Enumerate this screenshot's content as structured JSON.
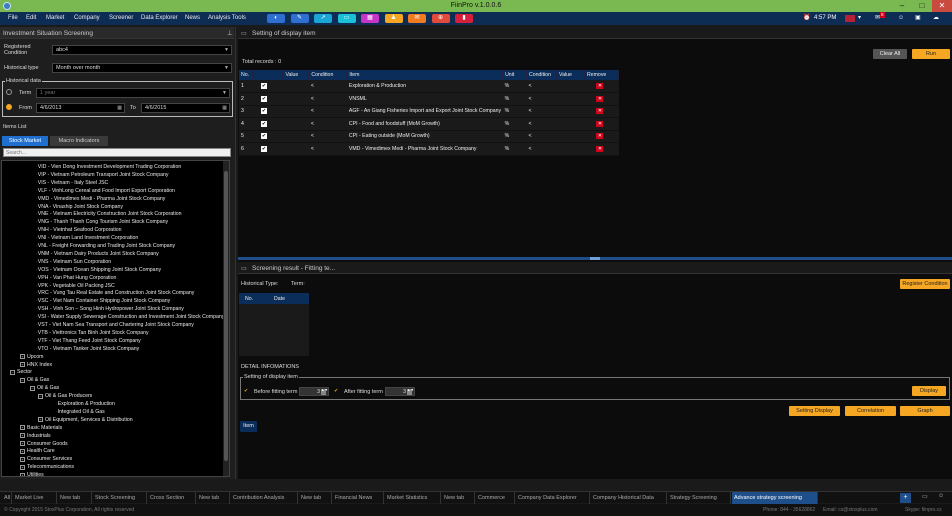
{
  "titlebar": {
    "title": "FiinPro v.1.0.0.6",
    "min": "–",
    "max": "□",
    "close": "✕"
  },
  "menu": [
    "File",
    "Edit",
    "Market",
    "Company",
    "Screener",
    "Data Explorer",
    "News",
    "Analysis Tools"
  ],
  "toolbar_icons": [
    {
      "icon": "chart-icon",
      "color": "#2f6fd1",
      "glyph": "◐"
    },
    {
      "icon": "finance-icon",
      "color": "#2f6fd1",
      "glyph": "✎"
    },
    {
      "icon": "line-chart-icon",
      "color": "#19a6d6",
      "glyph": "↗"
    },
    {
      "icon": "monitor-icon",
      "color": "#19c0d6",
      "glyph": "▭"
    },
    {
      "icon": "grid-icon",
      "color": "#c536c8",
      "glyph": "▦"
    },
    {
      "icon": "people-icon",
      "color": "#f5a623",
      "glyph": "♟"
    },
    {
      "icon": "news-icon",
      "color": "#f07b21",
      "glyph": "✉"
    },
    {
      "icon": "target-icon",
      "color": "#e24b3b",
      "glyph": "⊕"
    },
    {
      "icon": "bar-chart-icon",
      "color": "#d61f3a",
      "glyph": "▮"
    }
  ],
  "tray": {
    "time": "4:57 PM",
    "badge": "8"
  },
  "left": {
    "header": "Investment Situation Screening",
    "registered_label": "Registered Condition",
    "registered_value": "abc4",
    "historical_type_label": "Historical type",
    "historical_type_value": "Month over month",
    "historical_data_label": "Historical data",
    "term_label": "Term",
    "term_value": "1 year",
    "from_label": "From",
    "from_value": "4/6/2013",
    "to_label": "To",
    "to_value": "4/6/2015",
    "items_list_label": "Items List",
    "tab_stock": "Stock Market",
    "tab_macro": "Macro Indicators",
    "search_placeholder": "Search...",
    "tree": [
      {
        "t": "VID - Vien Dong Investment Development Trading Corporation",
        "x": 34
      },
      {
        "t": "VIP - Vietnam Petroleum Transport Joint Stock Company",
        "x": 34
      },
      {
        "t": "VIS - Vietnam - Italy Steel JSC",
        "x": 34
      },
      {
        "t": "VLF - VinhLong Cereal and Food Import Export Corporation",
        "x": 34
      },
      {
        "t": "VMD - Vimedimex Medi - Pharma Joint Stock Company",
        "x": 34
      },
      {
        "t": "VNA - Vinaship Joint Stock Company",
        "x": 34
      },
      {
        "t": "VNE - Vietnam Electricity Construction Joint Stock Corporation",
        "x": 34
      },
      {
        "t": "VNG - Thanh Thanh Cong Tourism Joint Stock Company",
        "x": 34
      },
      {
        "t": "VNH - Vietnhat Seafood Corporation",
        "x": 34
      },
      {
        "t": "VNI - Vietnam Land Investment Corporation",
        "x": 34
      },
      {
        "t": "VNL - Freight Forwarding and Trading Joint Stock Company",
        "x": 34
      },
      {
        "t": "VNM - Vietnam Dairy Products Joint Stock Company",
        "x": 34
      },
      {
        "t": "VNS - Vietnam Sun Corporation",
        "x": 34
      },
      {
        "t": "VOS - Vietnam Ocean Shipping Joint Stock Company",
        "x": 34
      },
      {
        "t": "VPH - Van Phat Hung Corporation",
        "x": 34
      },
      {
        "t": "VPK - Vegetable Oil Packing JSC",
        "x": 34
      },
      {
        "t": "VRC - Vung Tau Real Estate and Construction Joint Stock Company",
        "x": 34
      },
      {
        "t": "VSC - Viet Nam Container Shipping Joint Stock Company",
        "x": 34
      },
      {
        "t": "VSH - Vinh Son – Song Hinh Hydropower Joint Stock Company",
        "x": 34
      },
      {
        "t": "VSI - Water Supply Sewerage Construction and Investment Joint Stock Company",
        "x": 34
      },
      {
        "t": "VST - Viet Nam Sea Transport and Chartering Joint Stock Company",
        "x": 34
      },
      {
        "t": "VTB - Viettronics Tan Binh Joint Stock Company",
        "x": 34
      },
      {
        "t": "VTF - Viet Thang Feed Joint Stock Company",
        "x": 34
      },
      {
        "t": "VTO - Vietnam Tanker Joint Stock Company",
        "x": 34
      },
      {
        "t": "Upcom",
        "x": 18,
        "exp": "+"
      },
      {
        "t": "HNX Index",
        "x": 18,
        "exp": "+"
      },
      {
        "t": "Sector",
        "x": 8,
        "exp": "−"
      },
      {
        "t": "Oil & Gas",
        "x": 18,
        "exp": "−"
      },
      {
        "t": "Oil & Gas",
        "x": 28,
        "exp": "−"
      },
      {
        "t": "Oil & Gas Producers",
        "x": 36,
        "exp": "−"
      },
      {
        "t": "Exploration & Production",
        "x": 54
      },
      {
        "t": "Integrated Oil & Gas",
        "x": 54
      },
      {
        "t": "Oil Equipment, Services & Distribution",
        "x": 36,
        "exp": "+"
      },
      {
        "t": "Basic Materials",
        "x": 18,
        "exp": "+"
      },
      {
        "t": "Industrials",
        "x": 18,
        "exp": "+"
      },
      {
        "t": "Consumer Goods",
        "x": 18,
        "exp": "+"
      },
      {
        "t": "Health Care",
        "x": 18,
        "exp": "+"
      },
      {
        "t": "Consumer Services",
        "x": 18,
        "exp": "+"
      },
      {
        "t": "Telecommunications",
        "x": 18,
        "exp": "+"
      },
      {
        "t": "Utilities",
        "x": 18,
        "exp": "+"
      }
    ]
  },
  "right": {
    "display_header": "Setting of display item",
    "clear_all": "Clear All",
    "run": "Run",
    "total_records": "Total records : 0",
    "columns": [
      "No.",
      "",
      "Value",
      "Condition",
      "Item",
      "Unit",
      "Condition",
      "Value",
      "Remove"
    ],
    "rows": [
      {
        "no": "1",
        "cond": "<",
        "item": "Exploration & Production",
        "unit": "%",
        "cond2": "<"
      },
      {
        "no": "2",
        "cond": "<",
        "item": "VNSML",
        "unit": "%",
        "cond2": "<"
      },
      {
        "no": "3",
        "cond": "<",
        "item": "AGF - An Giang Fisheries Import and Export Joint Stock Company",
        "unit": "%",
        "cond2": "<"
      },
      {
        "no": "4",
        "cond": "<",
        "item": "CPI - Food and foodstuff (MoM Growth)",
        "unit": "%",
        "cond2": "<"
      },
      {
        "no": "5",
        "cond": "<",
        "item": "CPI - Eating outside (MoM Growth)",
        "unit": "%",
        "cond2": "<"
      },
      {
        "no": "6",
        "cond": "<",
        "item": "VMD - Vimedimex Medi - Pharma Joint Stock Company",
        "unit": "%",
        "cond2": "<"
      }
    ],
    "result_header": "Screening result - Fitting te...",
    "historical_type_label": "Historical Type:",
    "term_label": "Term:",
    "register_condition": "Register Condition",
    "result_columns": [
      "No.",
      "Date"
    ],
    "detail_label": "DETAIL INFOMATIONS",
    "setting_display_item": "Setting of display item",
    "before_fitting": "Before fitting term",
    "after_fitting": "After fitting term",
    "before_value": "3",
    "after_value": "3",
    "display_btn": "Display",
    "setting_display_btn": "Setting Display",
    "correlation_btn": "Correlation",
    "graph_btn": "Graph",
    "item_tab": "Item"
  },
  "taskbar": [
    "All",
    "Market Live",
    "New tab",
    "Stock Screening",
    "Cross Section",
    "New tab",
    "Contribution Analysis",
    "New tab",
    "Financial News",
    "Market Statistics",
    "New tab",
    "Commerce",
    "Company Data Explorer",
    "Company Historical Data",
    "Strategy Screening",
    "Advance strategy screening"
  ],
  "status": {
    "copyright": "© Copyright 2015 StoxPlus Corporation, All rights reserved",
    "phone": "Phone: 844 - 35628862",
    "email": "Email: cs@stoxplus.com",
    "skype": "Skype: fiinpro.cs"
  }
}
